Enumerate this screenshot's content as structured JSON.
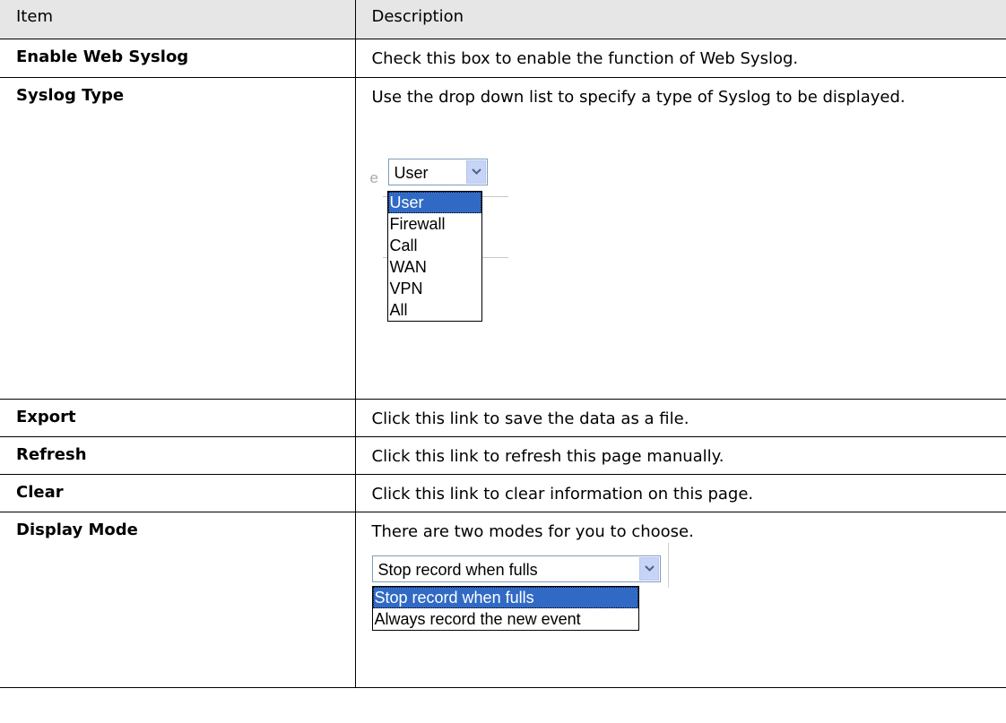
{
  "table": {
    "header": {
      "item": "Item",
      "description": "Description"
    },
    "rows": [
      {
        "item": "Enable Web Syslog",
        "description": "Check this box to enable the function of Web Syslog."
      },
      {
        "item": "Syslog Type",
        "description": "Use the drop down list to specify a type of Syslog to be displayed."
      },
      {
        "item": "Export",
        "description": "Click this link to save the data as a file."
      },
      {
        "item": "Refresh",
        "description": "Click this link to refresh this page manually."
      },
      {
        "item": "Clear",
        "description": "Click this link to clear information on this page."
      },
      {
        "item": "Display Mode",
        "description": "There are two modes for you to choose."
      }
    ]
  },
  "syslog_type_dropdown": {
    "ghost_label": "e",
    "selected": "User",
    "options": [
      "User",
      "Firewall",
      "Call",
      "WAN",
      "VPN",
      "All"
    ]
  },
  "display_mode_dropdown": {
    "selected": "Stop record when fulls",
    "options": [
      "Stop record when fulls",
      "Always record the new event"
    ]
  },
  "icons": {
    "dropdown_arrow": "chevron-down-icon"
  },
  "colors": {
    "header_bg": "#e6e6e6",
    "selection": "#316ac5",
    "dropdown_button": "#c6d4f7"
  }
}
